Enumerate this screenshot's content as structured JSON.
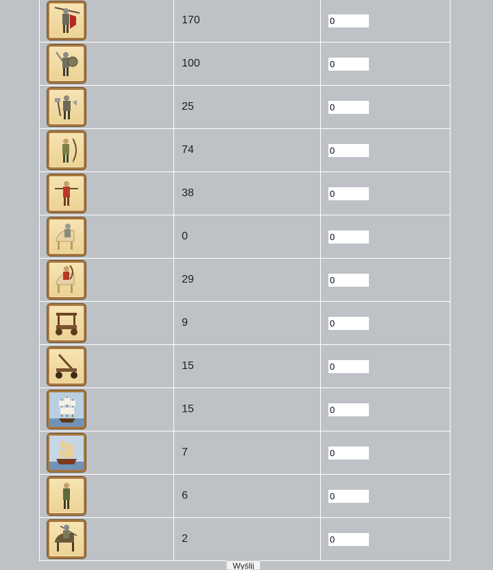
{
  "units": [
    {
      "icon": "spearman-icon",
      "count": "170",
      "qty": "0"
    },
    {
      "icon": "swordsman-icon",
      "count": "100",
      "qty": "0"
    },
    {
      "icon": "axeman-icon",
      "count": "25",
      "qty": "0"
    },
    {
      "icon": "archer-icon",
      "count": "74",
      "qty": "0"
    },
    {
      "icon": "crossbowman-icon",
      "count": "38",
      "qty": "0"
    },
    {
      "icon": "armored-knight-icon",
      "count": "0",
      "qty": "0"
    },
    {
      "icon": "mounted-archer-icon",
      "count": "29",
      "qty": "0"
    },
    {
      "icon": "ram-icon",
      "count": "9",
      "qty": "0"
    },
    {
      "icon": "catapult-icon",
      "count": "15",
      "qty": "0"
    },
    {
      "icon": "transport-ship-icon",
      "count": "15",
      "qty": "0"
    },
    {
      "icon": "galleon-icon",
      "count": "7",
      "qty": "0"
    },
    {
      "icon": "scout-icon",
      "count": "6",
      "qty": "0"
    },
    {
      "icon": "light-cavalry-icon",
      "count": "2",
      "qty": "0"
    }
  ],
  "submit_label": "Wyślij"
}
